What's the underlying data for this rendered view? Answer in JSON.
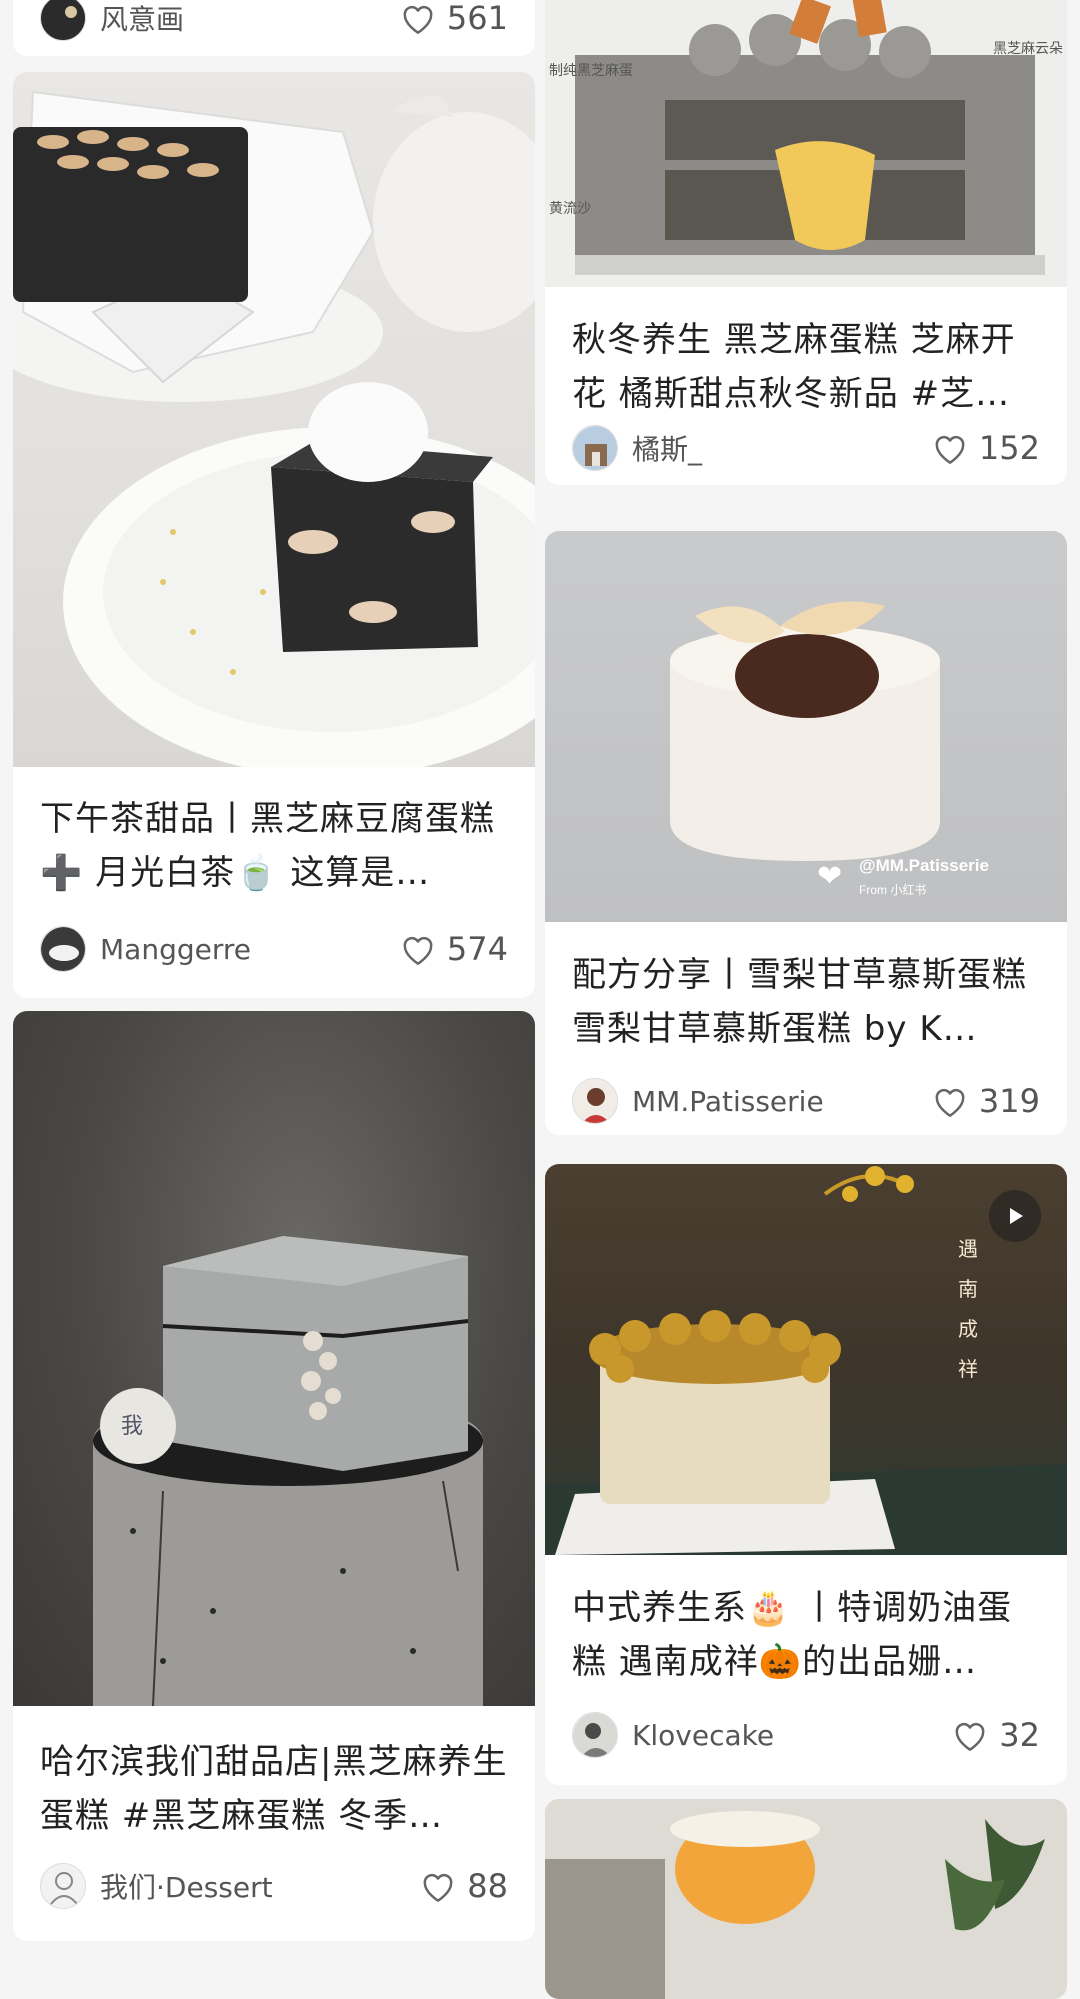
{
  "feed": {
    "left": [
      {
        "author": "风意画",
        "likes": "561"
      },
      {
        "title": "下午茶甜品丨黑芝麻豆腐蛋糕 ➕ 月光白茶🍵 这算是…",
        "author": "Manggerre",
        "likes": "574"
      },
      {
        "title": "哈尔滨我们甜品店|黑芝麻养生蛋糕 #黑芝麻蛋糕  冬季…",
        "author": "我们·Dessert",
        "likes": "88"
      }
    ],
    "right": [
      {
        "title": "秋冬养生 黑芝麻蛋糕 芝麻开花 橘斯甜点秋冬新品 #芝…",
        "author": "橘斯_",
        "likes": "152",
        "image_texts": [
          "制纯黑芝麻蛋",
          "黑芝麻云朵",
          "黄流沙"
        ]
      },
      {
        "title": "配方分享丨雪梨甘草慕斯蛋糕 雪梨甘草慕斯蛋糕 by K…",
        "author": "MM.Patisserie",
        "likes": "319",
        "watermark": "@MM.Patisserie",
        "watermark_sub": "From 小红书"
      },
      {
        "title": "中式养生系🎂 丨特调奶油蛋糕 遇南成祥🎃的出品姗…",
        "author": "Klovecake",
        "likes": "32",
        "calligraphy": [
          "遇",
          "南",
          "成",
          "祥"
        ],
        "has_video": true
      }
    ]
  },
  "icons": {
    "like": "heart-outline-icon",
    "video": "play-icon"
  },
  "colors": {
    "background": "#f5f5f5",
    "card": "#ffffff",
    "title": "#222222",
    "meta": "#555555"
  }
}
